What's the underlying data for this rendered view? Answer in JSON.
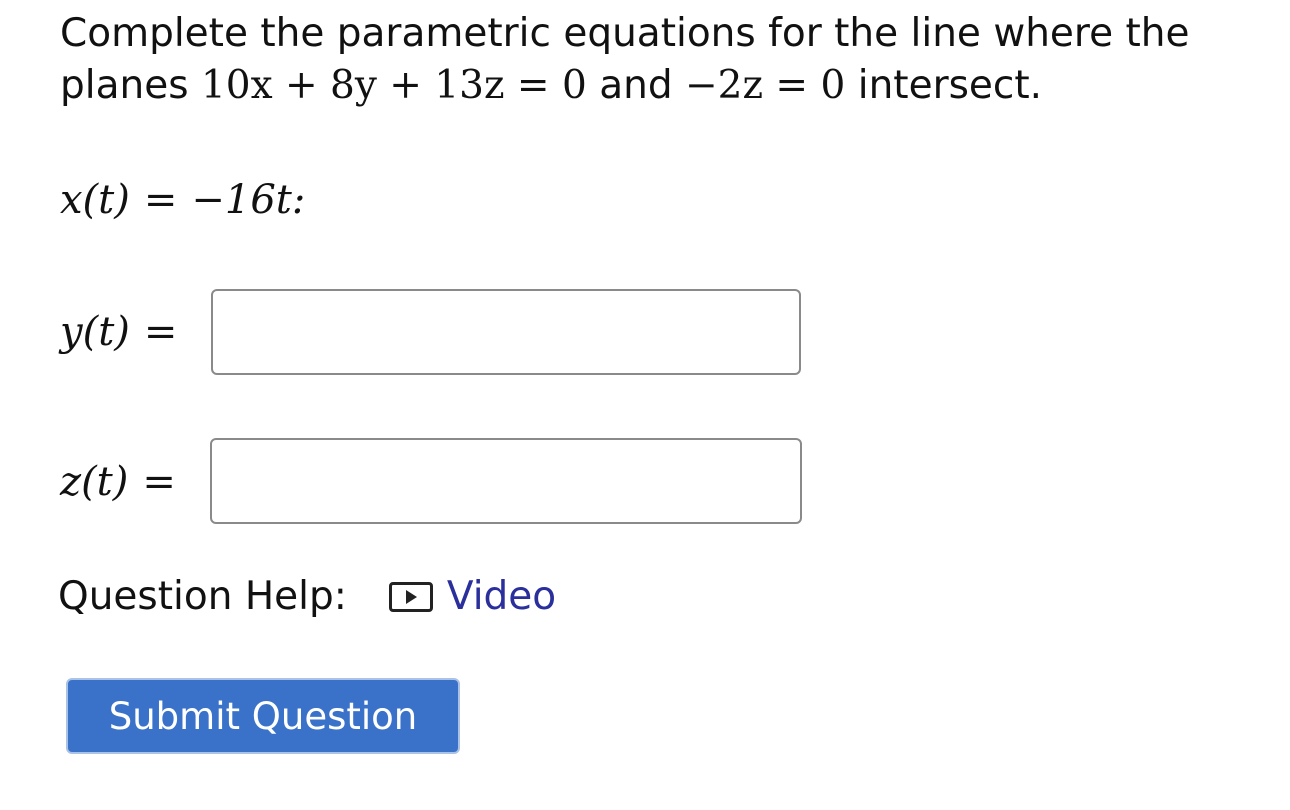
{
  "question": {
    "intro": "Complete the parametric equations for the line where the planes",
    "plane1": "10x + 8y + 13z = 0",
    "and": "and",
    "plane2": "−2z = 0",
    "end": "intersect."
  },
  "equations": {
    "x_label": "x(t)",
    "x_equals": "=",
    "x_value": "−16t:",
    "y_label": "y(t)",
    "y_equals": "=",
    "y_value": "",
    "z_label": "z(t)",
    "z_equals": "=",
    "z_value": ""
  },
  "help": {
    "label": "Question Help:",
    "video_label": "Video",
    "video_icon": "play-icon",
    "link_color": "#2a2f9c"
  },
  "submit": {
    "label": "Submit Question",
    "color": "#3b72c9"
  }
}
